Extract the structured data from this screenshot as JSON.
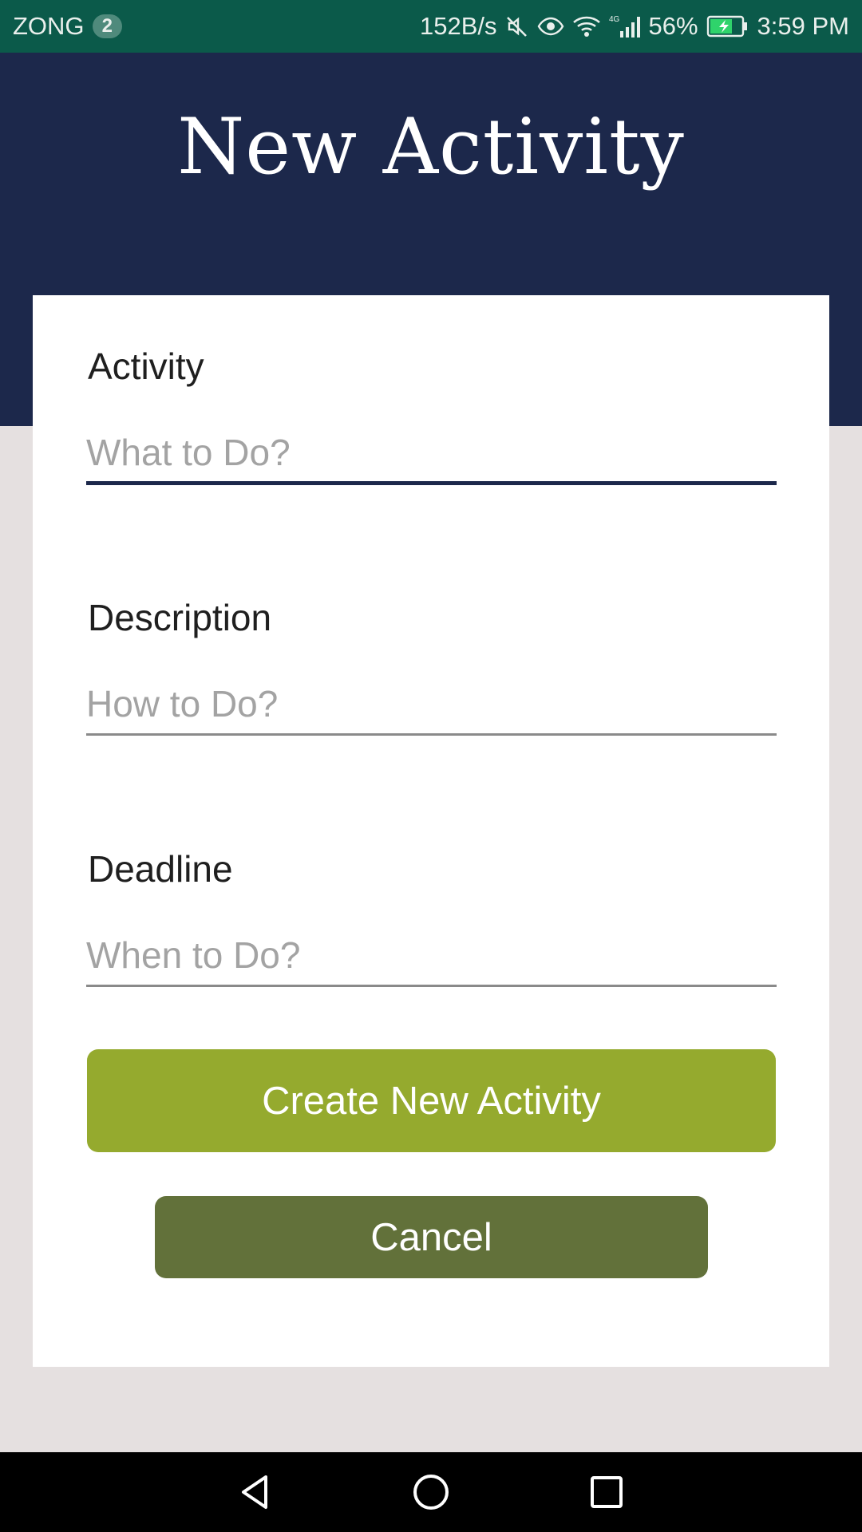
{
  "status_bar": {
    "carrier": "ZONG",
    "sim_badge": "2",
    "net_speed": "152B/s",
    "battery_percent": "56%",
    "time": "3:59 PM",
    "icons": [
      "mute-icon",
      "eye-icon",
      "wifi-icon",
      "4g-signal-icon",
      "battery-charging-icon"
    ],
    "color": "#0b5a4a"
  },
  "header": {
    "title": "New Activity",
    "color": "#1c284b"
  },
  "form": {
    "activity": {
      "label": "Activity",
      "placeholder": "What to Do?",
      "value": ""
    },
    "description": {
      "label": "Description",
      "placeholder": "How to Do?",
      "value": ""
    },
    "deadline": {
      "label": "Deadline",
      "placeholder": "When to Do?",
      "value": ""
    }
  },
  "buttons": {
    "create_label": "Create New Activity",
    "create_color": "#95aa2e",
    "cancel_label": "Cancel",
    "cancel_color": "#62713a"
  },
  "nav_bar": {
    "icons": [
      "back-icon",
      "home-icon",
      "recents-icon"
    ]
  }
}
